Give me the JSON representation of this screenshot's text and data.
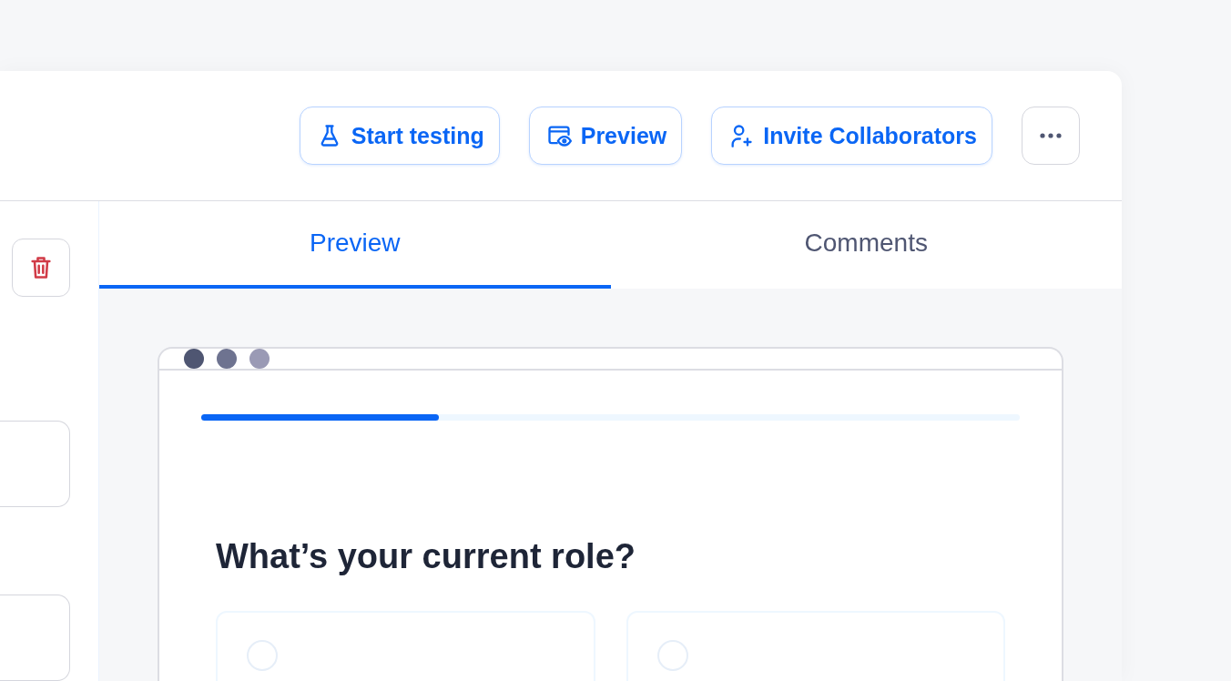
{
  "toolbar": {
    "buttons": [
      {
        "label": "Start testing",
        "kind": "flask"
      },
      {
        "label": "Preview",
        "kind": "preview"
      },
      {
        "label": "Invite Collaborators",
        "kind": "user-plus"
      }
    ]
  },
  "tabs": [
    {
      "label": "Preview",
      "selected": true
    },
    {
      "label": "Comments",
      "selected": false
    }
  ],
  "preview": {
    "window_dots": [
      {
        "color": "#4f5672"
      },
      {
        "color": "#6e7390"
      },
      {
        "color": "#9a9ab5"
      }
    ],
    "progress": {
      "level": 0.29
    },
    "question": "What’s your current role?",
    "options": [
      {
        "selected": false
      },
      {
        "selected": false
      }
    ]
  }
}
